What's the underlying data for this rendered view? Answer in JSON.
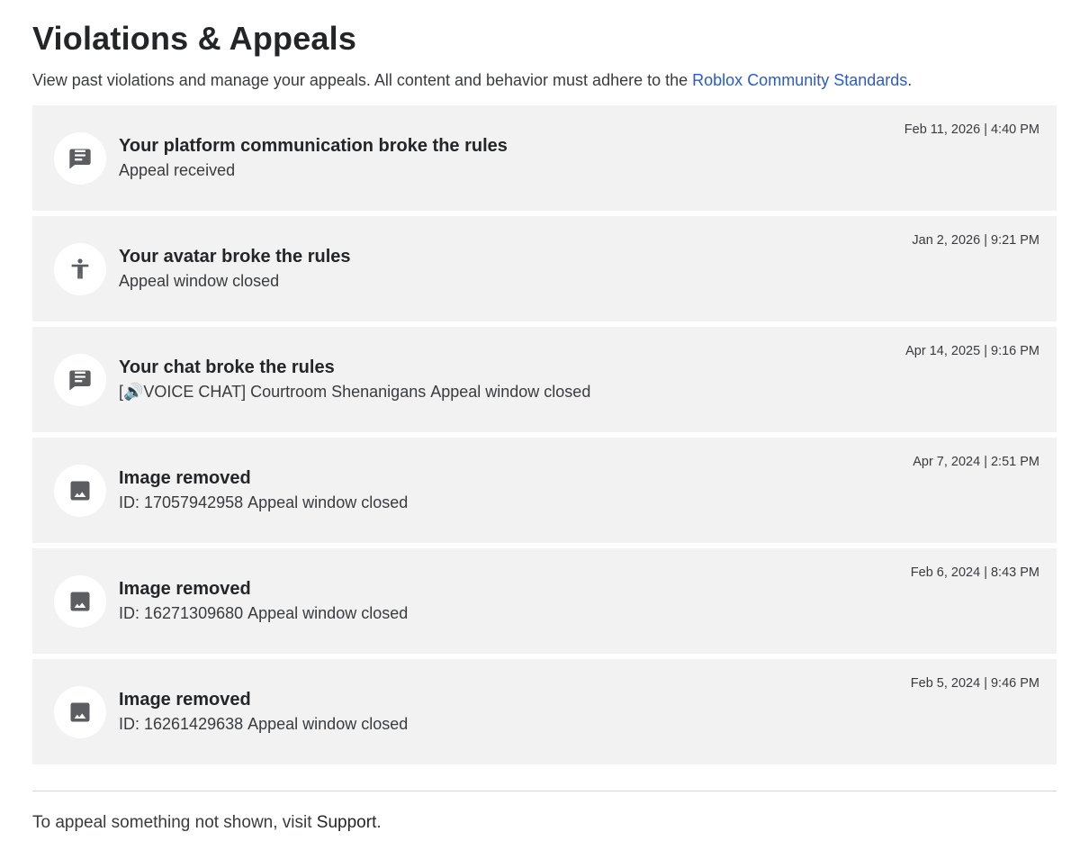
{
  "page": {
    "title": "Violations & Appeals",
    "intro_text": "View past violations and manage your appeals. All content and behavior must adhere to the",
    "intro_link": "Roblox Community Standards",
    "intro_end": "."
  },
  "violations": [
    {
      "icon": "message-icon",
      "title": "Your platform communication broke the rules",
      "detail": "",
      "status": "Appeal received",
      "date": "Feb 11, 2026 | 4:40 PM"
    },
    {
      "icon": "avatar-icon",
      "title": "Your avatar broke the rules",
      "detail": "",
      "status": "Appeal window closed",
      "date": "Jan 2, 2026 | 9:21 PM"
    },
    {
      "icon": "message-icon",
      "title": "Your chat broke the rules",
      "detail": "[🔊VOICE CHAT] Courtroom Shenanigans",
      "status": "Appeal window closed",
      "date": "Apr 14, 2025 | 9:16 PM"
    },
    {
      "icon": "image-icon",
      "title": "Image removed",
      "detail": "ID: 17057942958",
      "status": "Appeal window closed",
      "date": "Apr 7, 2024 | 2:51 PM"
    },
    {
      "icon": "image-icon",
      "title": "Image removed",
      "detail": "ID: 16271309680",
      "status": "Appeal window closed",
      "date": "Feb 6, 2024 | 8:43 PM"
    },
    {
      "icon": "image-icon",
      "title": "Image removed",
      "detail": "ID: 16261429638",
      "status": "Appeal window closed",
      "date": "Feb 5, 2024 | 9:46 PM"
    }
  ],
  "footer": {
    "text": "To appeal something not shown, visit",
    "link": "Support",
    "end": "."
  },
  "colors": {
    "link": "#2a5cc7",
    "card_background": "#f2f2f3",
    "icon": "#5b5d60"
  }
}
